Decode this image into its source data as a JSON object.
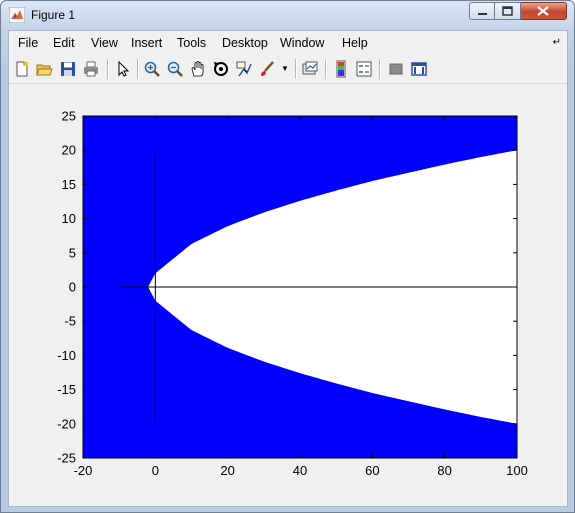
{
  "window": {
    "title": "Figure 1"
  },
  "menu": {
    "items": [
      "File",
      "Edit",
      "View",
      "Insert",
      "Tools",
      "Desktop",
      "Window",
      "Help"
    ]
  },
  "toolbar": {
    "icons": [
      "new-figure-icon",
      "open-file-icon",
      "save-icon",
      "print-icon",
      "edit-plot-icon",
      "zoom-in-icon",
      "zoom-out-icon",
      "pan-icon",
      "rotate-3d-icon",
      "data-cursor-icon",
      "brush-icon",
      "link-plot-icon",
      "insert-colorbar-icon",
      "insert-legend-icon",
      "hide-plot-tools-icon",
      "show-plot-tools-icon"
    ]
  },
  "colors": {
    "fill": "#0000ff",
    "region": "#ffffff",
    "axes_line": "#000000"
  },
  "chart_data": {
    "type": "area",
    "title": "",
    "xlabel": "",
    "ylabel": "",
    "xlim": [
      -20,
      100
    ],
    "ylim": [
      -25,
      25
    ],
    "xticks": [
      -20,
      0,
      20,
      40,
      60,
      80,
      100
    ],
    "yticks": [
      -25,
      -20,
      -15,
      -10,
      -5,
      0,
      5,
      10,
      15,
      20,
      25
    ],
    "grid": false,
    "background_fill": "blue",
    "region": {
      "name": "",
      "x": [
        -2,
        0,
        10,
        20,
        30,
        40,
        50,
        60,
        70,
        80,
        90,
        100
      ],
      "y_upper": [
        0,
        2,
        6.3,
        8.9,
        10.9,
        12.6,
        14.1,
        15.5,
        16.7,
        17.9,
        19.0,
        20.0
      ],
      "y_lower": [
        0,
        -2,
        -6.3,
        -8.9,
        -10.9,
        -12.6,
        -14.1,
        -15.5,
        -16.7,
        -17.9,
        -19.0,
        -20.0
      ]
    },
    "lines": [
      {
        "x": [
          -10,
          100
        ],
        "y": [
          0,
          0
        ]
      },
      {
        "x": [
          0,
          0
        ],
        "y": [
          -20,
          20
        ]
      }
    ]
  }
}
